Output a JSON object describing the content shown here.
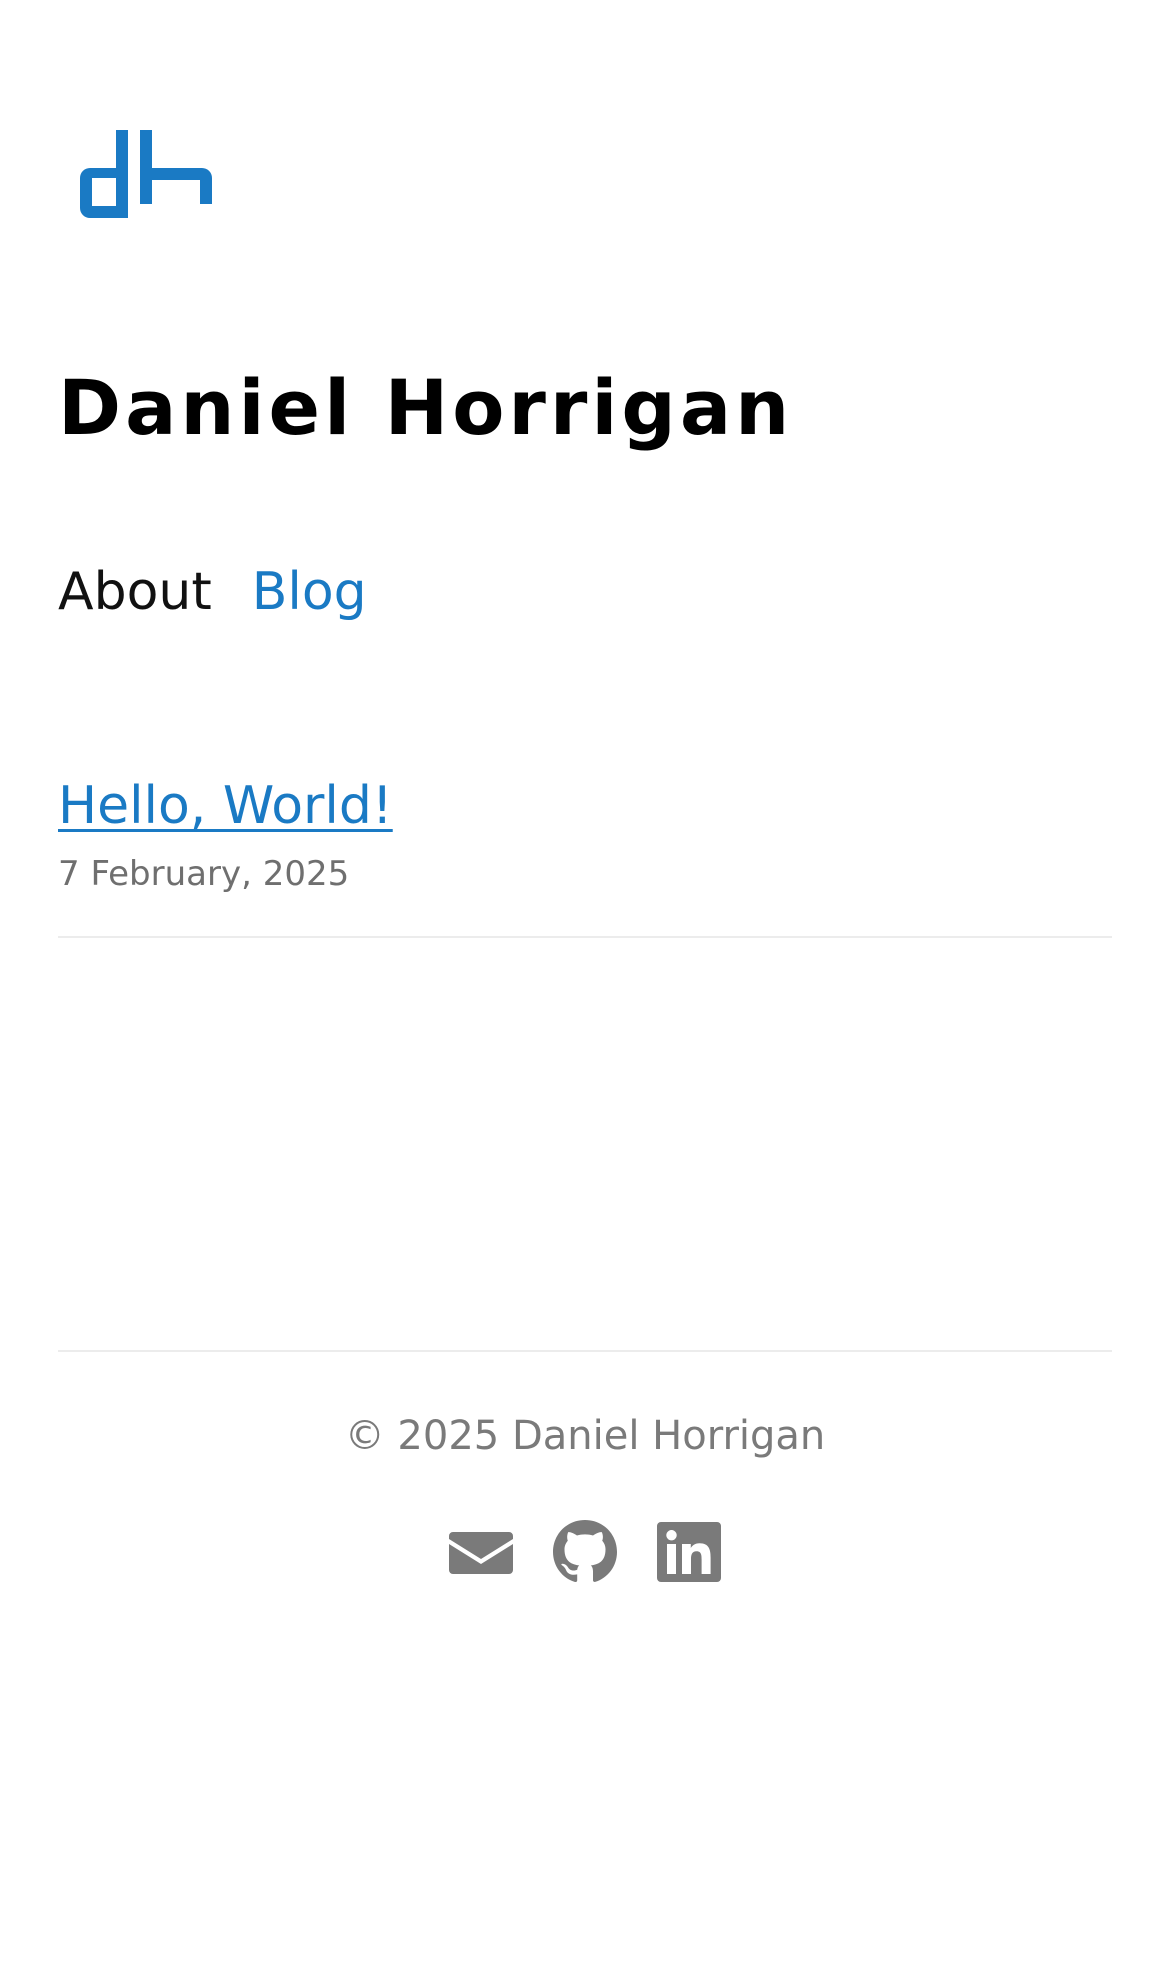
{
  "header": {
    "logo_text": "dh",
    "site_title": "Daniel Horrigan"
  },
  "nav": {
    "items": [
      {
        "label": "About",
        "active": false
      },
      {
        "label": "Blog",
        "active": true
      }
    ]
  },
  "posts": [
    {
      "title": "Hello, World!",
      "date": "7 February, 2025"
    }
  ],
  "footer": {
    "copyright": "© 2025 Daniel Horrigan",
    "social": [
      {
        "icon": "envelope-icon"
      },
      {
        "icon": "github-icon"
      },
      {
        "icon": "linkedin-icon"
      }
    ]
  },
  "colors": {
    "accent": "#1a7ac4",
    "text": "#000000",
    "muted": "#7a7a7a",
    "divider": "#ececec"
  }
}
